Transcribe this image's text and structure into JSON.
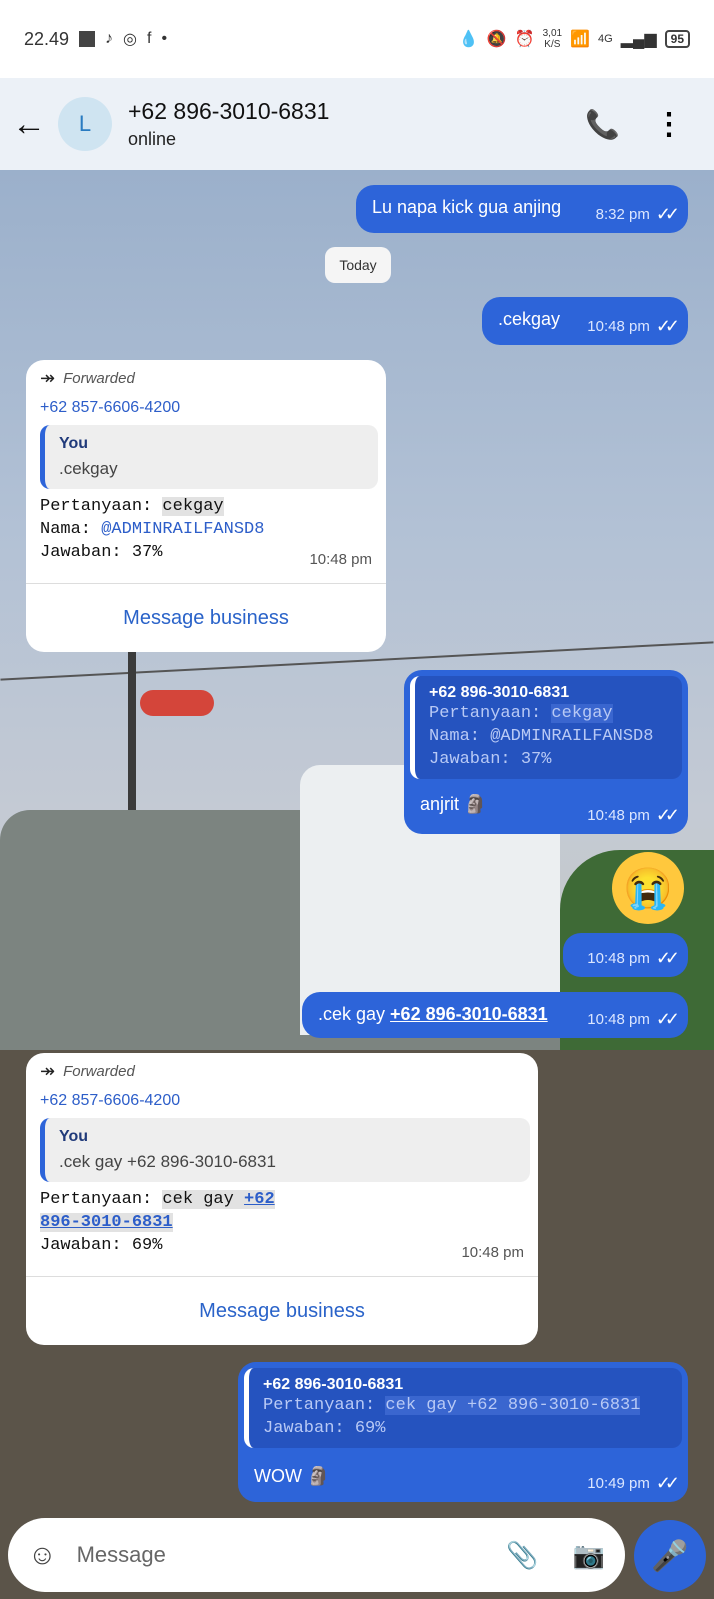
{
  "status_bar": {
    "time": "22.49",
    "speed": "3,01",
    "speed_unit": "K/S",
    "network": "4G",
    "battery": "95"
  },
  "header": {
    "avatar_letter": "L",
    "contact": "+62 896-3010-6831",
    "status": "online"
  },
  "messages": {
    "m1": {
      "text": "Lu napa kick gua anjing",
      "time": "8:32 pm"
    },
    "date": "Today",
    "m2": {
      "text": ".cekgay",
      "time": "10:48 pm"
    },
    "m3": {
      "forwarded": "Forwarded",
      "from": "+62 857-6606-4200",
      "quote_name": "You",
      "quote_text": ".cekgay",
      "l1_label": "Pertanyaan: ",
      "l1_value": "cekgay",
      "l2_label": "Nama: ",
      "l2_value": "@ADMINRAILFANSD8",
      "l3": "Jawaban: 37%",
      "time": "10:48 pm",
      "action": "Message business"
    },
    "m4": {
      "quote_name": "+62 896-3010-6831",
      "q1_label": "Pertanyaan: ",
      "q1_value": "cekgay",
      "q2": "Nama: @ADMINRAILFANSD8",
      "q3": "Jawaban: 37%",
      "text": "anjrit 🗿",
      "time": "10:48 pm"
    },
    "m5": {
      "emoji": "😭",
      "time": "10:48 pm"
    },
    "m6": {
      "text": ".cek gay ",
      "link": "+62 896-3010-6831",
      "time": "10:48 pm"
    },
    "m7": {
      "forwarded": "Forwarded",
      "from": "+62 857-6606-4200",
      "quote_name": "You",
      "quote_text": ".cek gay +62 896-3010-6831",
      "l1_label": "Pertanyaan: ",
      "l1_value": "cek gay ",
      "l1_link_a": "+62",
      "l1_link_b": "896-3010-6831",
      "l3": "Jawaban: 69%",
      "time": "10:48 pm",
      "action": "Message business"
    },
    "m8": {
      "quote_name": "+62 896-3010-6831",
      "q1_label": "Pertanyaan: ",
      "q1_value": "cek gay +62 896-3010-6831",
      "q2": "Jawaban: 69%",
      "text": "WOW 🗿",
      "time": "10:49 pm"
    }
  },
  "input": {
    "placeholder": "Message"
  },
  "icons": {
    "back": "arrow-left",
    "call": "phone-plus",
    "more": "vertical-dots",
    "emoji": "sticker-face",
    "attach": "paperclip",
    "camera": "camera",
    "mic": "microphone",
    "read": "double-check"
  },
  "colors": {
    "outgoing": "#2d64d9",
    "incoming": "#ffffff",
    "header_bg": "#ecf1f7",
    "link": "#2d5ec9"
  }
}
